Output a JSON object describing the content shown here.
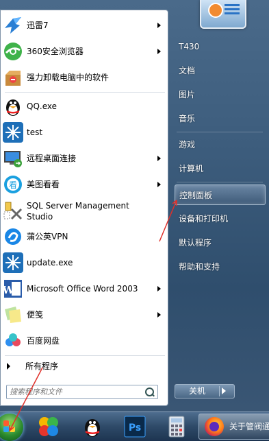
{
  "right_panel": {
    "items": [
      {
        "label": "T430"
      },
      {
        "label": "文档"
      },
      {
        "label": "图片"
      },
      {
        "label": "音乐"
      },
      {
        "label": "游戏"
      },
      {
        "label": "计算机"
      },
      {
        "label": "控制面板",
        "highlighted": true
      },
      {
        "label": "设备和打印机"
      },
      {
        "label": "默认程序"
      },
      {
        "label": "帮助和支持"
      }
    ],
    "shutdown_label": "关机"
  },
  "programs": [
    {
      "label": "迅雷7",
      "icon": "xunlei-bird-icon",
      "submenu": true
    },
    {
      "label": "360安全浏览器",
      "icon": "360-browser-icon",
      "submenu": true
    },
    {
      "label": "强力卸载电脑中的软件",
      "icon": "uninstall-box-icon",
      "submenu": false
    },
    {
      "label": "QQ.exe",
      "icon": "qq-penguin-icon",
      "submenu": false
    },
    {
      "label": "test",
      "icon": "snowflake-app-icon",
      "submenu": false
    },
    {
      "label": "远程桌面连接",
      "icon": "remote-desktop-icon",
      "submenu": true
    },
    {
      "label": "美图看看",
      "icon": "meitu-viewer-icon",
      "submenu": true
    },
    {
      "label": "SQL Server Management Studio",
      "icon": "sql-server-icon",
      "submenu": false
    },
    {
      "label": "蒲公英VPN",
      "icon": "vpn-icon",
      "submenu": false
    },
    {
      "label": "update.exe",
      "icon": "snowflake-app-icon",
      "submenu": false
    },
    {
      "label": "Microsoft Office Word 2003",
      "icon": "word-icon",
      "submenu": true
    },
    {
      "label": "便笺",
      "icon": "sticky-notes-icon",
      "submenu": true
    },
    {
      "label": "百度网盘",
      "icon": "baidu-cloud-icon",
      "submenu": false
    }
  ],
  "all_programs_label": "所有程序",
  "search": {
    "placeholder": "搜索程序和文件"
  },
  "taskbar": {
    "pinned": [
      "pinwheel-icon",
      "qq-penguin-icon",
      "photoshop-icon",
      "calculator-icon"
    ],
    "photoshop_text": "Ps",
    "active_window_label": "关于管阀通"
  },
  "colors": {
    "annotation": "#e0302a",
    "highlight": "#6a86a4"
  }
}
